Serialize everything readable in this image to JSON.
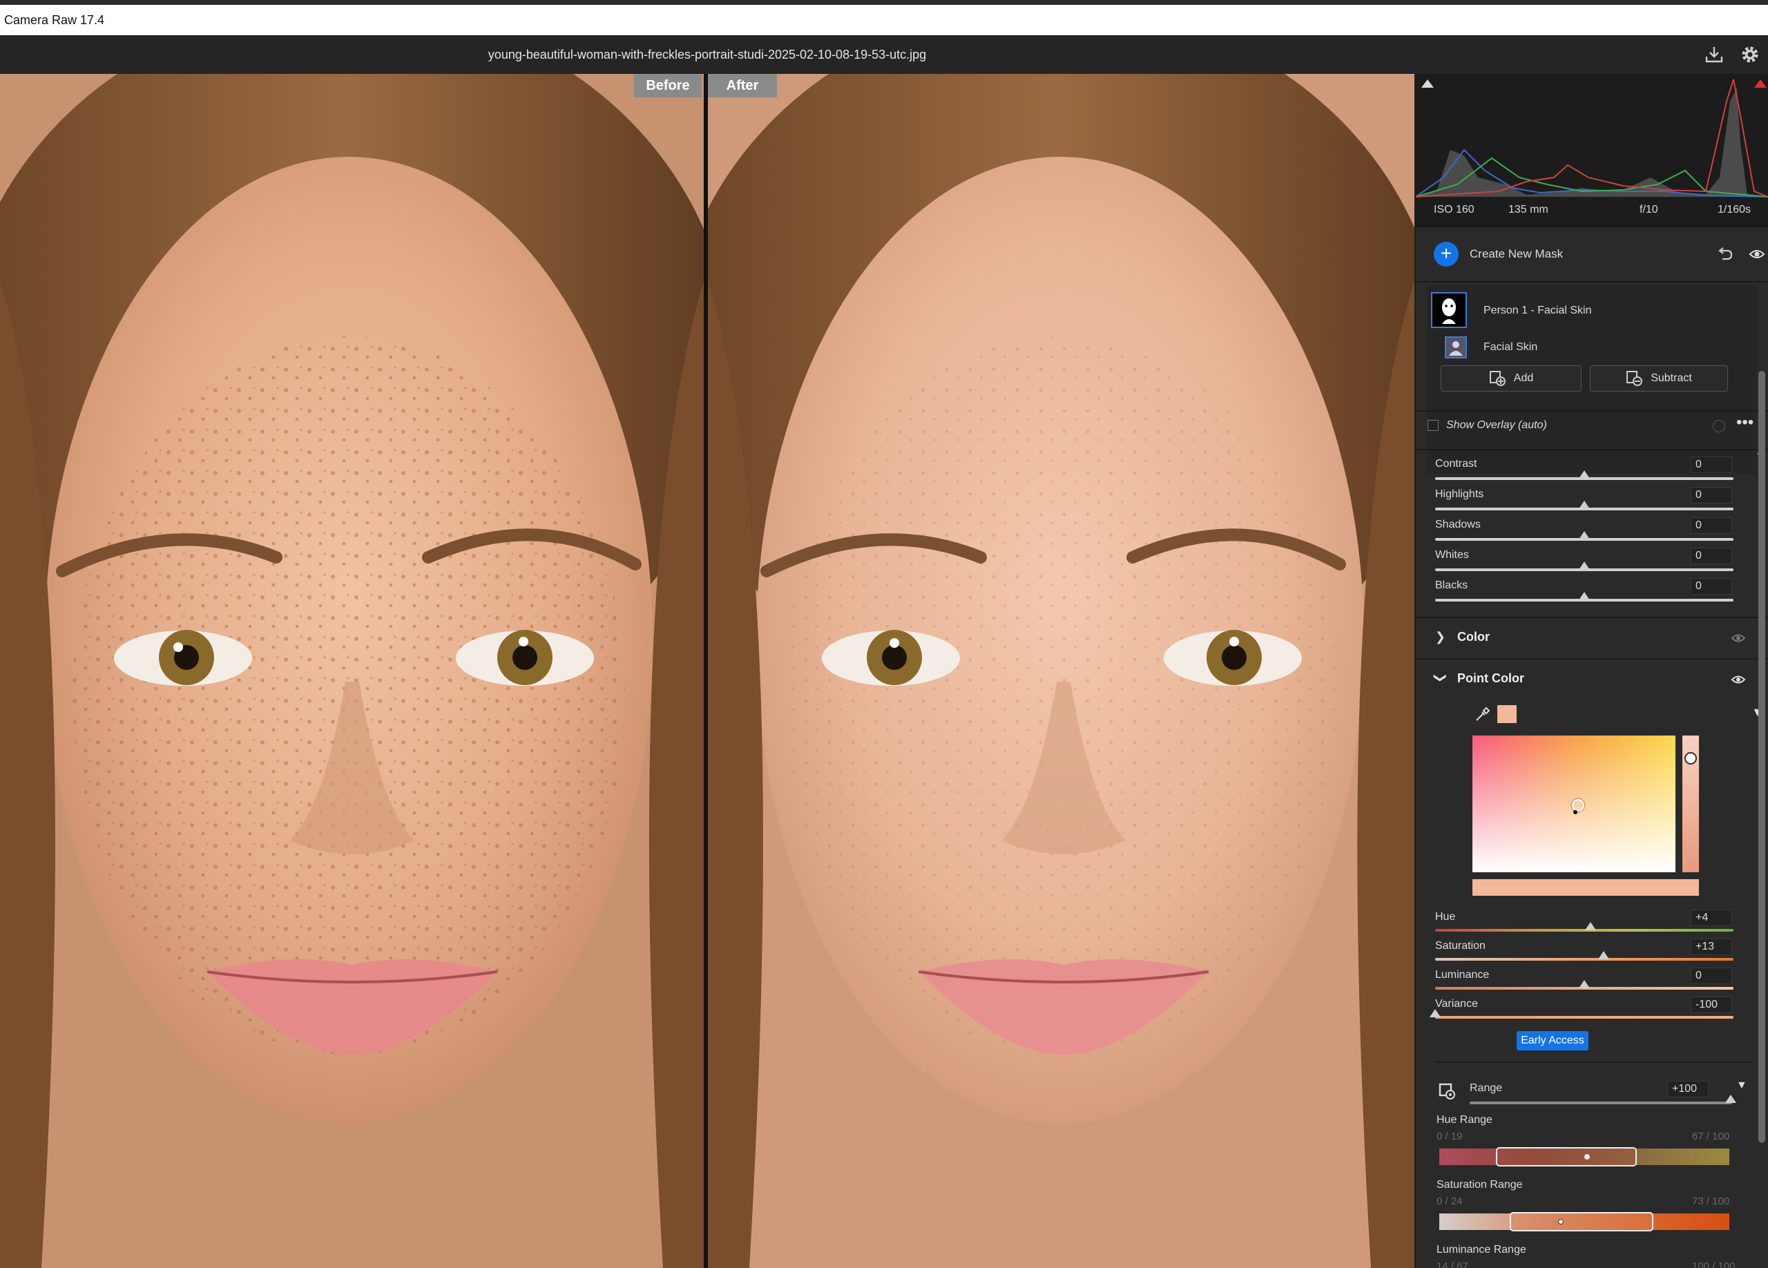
{
  "app": {
    "title": "Camera Raw 17.4"
  },
  "header": {
    "filename": "young-beautiful-woman-with-freckles-portrait-studi-2025-02-10-08-19-53-utc.jpg",
    "icons": [
      "save-icon",
      "gear-icon"
    ]
  },
  "viewer": {
    "before_label": "Before",
    "after_label": "After"
  },
  "histogram": {
    "iso": "ISO 160",
    "focal": "135 mm",
    "aperture": "f/10",
    "shutter": "1/160s"
  },
  "masks": {
    "create_label": "Create New Mask",
    "mask_name": "Person 1 - Facial Skin",
    "component_name": "Facial Skin",
    "add_label": "Add",
    "subtract_label": "Subtract",
    "overlay_label": "Show Overlay (auto)"
  },
  "light": {
    "sliders": [
      {
        "label": "Contrast",
        "value": "0",
        "pos": 0.5
      },
      {
        "label": "Highlights",
        "value": "0",
        "pos": 0.5
      },
      {
        "label": "Shadows",
        "value": "0",
        "pos": 0.5
      },
      {
        "label": "Whites",
        "value": "0",
        "pos": 0.5
      },
      {
        "label": "Blacks",
        "value": "0",
        "pos": 0.5
      }
    ]
  },
  "color_section": {
    "title": "Color"
  },
  "point_color": {
    "title": "Point Color",
    "sampled_color": "#f3b79a",
    "sliders": [
      {
        "label": "Hue",
        "value": "+4",
        "pos": 0.52
      },
      {
        "label": "Saturation",
        "value": "+13",
        "pos": 0.565
      },
      {
        "label": "Luminance",
        "value": "0",
        "pos": 0.5
      },
      {
        "label": "Variance",
        "value": "-100",
        "pos": 0.0
      }
    ],
    "early_access_label": "Early Access",
    "range_label": "Range",
    "range_value": "+100",
    "hue_range": {
      "title": "Hue Range",
      "min": "0 / 19",
      "max": "67 / 100"
    },
    "saturation_range": {
      "title": "Saturation Range",
      "min": "0 / 24",
      "max": "73 / 100"
    },
    "luminance_range": {
      "title": "Luminance Range",
      "min": "14 / 67",
      "max": "100 / 100"
    }
  },
  "colors": {
    "accent": "#1473e6",
    "panel": "#2a2a2a"
  }
}
